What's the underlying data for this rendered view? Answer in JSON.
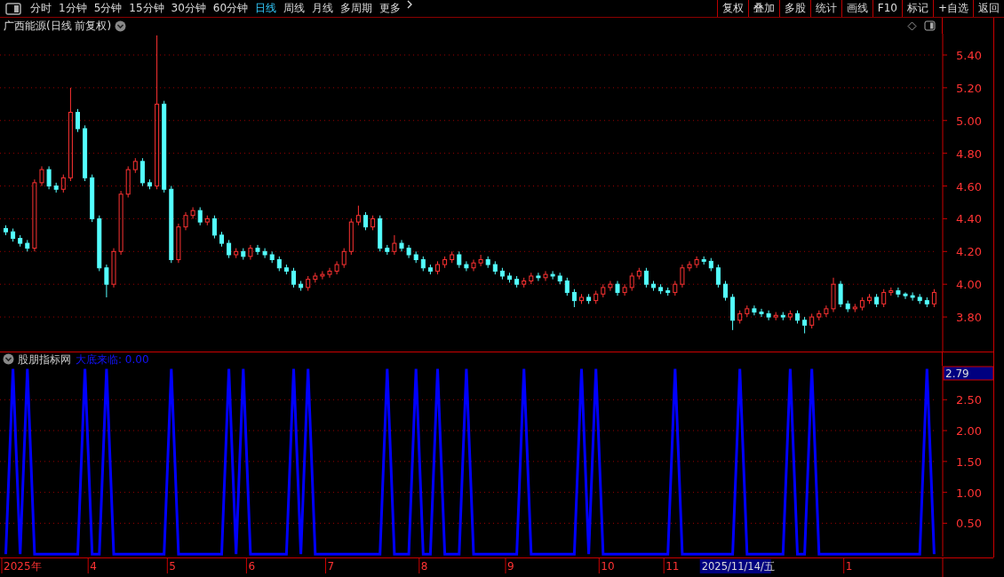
{
  "toolbar": {
    "periods": [
      {
        "label": "分时",
        "selected": false
      },
      {
        "label": "1分钟",
        "selected": false
      },
      {
        "label": "5分钟",
        "selected": false
      },
      {
        "label": "15分钟",
        "selected": false
      },
      {
        "label": "30分钟",
        "selected": false
      },
      {
        "label": "60分钟",
        "selected": false
      },
      {
        "label": "日线",
        "selected": true
      },
      {
        "label": "周线",
        "selected": false
      },
      {
        "label": "月线",
        "selected": false
      },
      {
        "label": "多周期",
        "selected": false
      },
      {
        "label": "更多",
        "selected": false
      }
    ],
    "buttons": [
      "复权",
      "叠加",
      "多股",
      "统计",
      "画线",
      "F10",
      "标记",
      "+自选",
      "返回"
    ]
  },
  "price_chart": {
    "title": "广西能源(日线 前复权)",
    "chart_data": {
      "type": "candlestick",
      "grid": true,
      "ylim": [
        3.589,
        5.53
      ],
      "ohlc": [
        [
          4.34,
          4.36,
          4.3,
          4.32
        ],
        [
          4.32,
          4.34,
          4.26,
          4.28
        ],
        [
          4.28,
          4.3,
          4.23,
          4.25
        ],
        [
          4.25,
          4.27,
          4.2,
          4.22
        ],
        [
          4.22,
          4.64,
          4.2,
          4.62
        ],
        [
          4.62,
          4.72,
          4.6,
          4.7
        ],
        [
          4.7,
          4.72,
          4.58,
          4.6
        ],
        [
          4.6,
          4.62,
          4.56,
          4.58
        ],
        [
          4.58,
          4.67,
          4.56,
          4.65
        ],
        [
          4.65,
          5.2,
          4.63,
          5.05
        ],
        [
          5.05,
          5.07,
          4.93,
          4.95
        ],
        [
          4.95,
          4.97,
          4.63,
          4.65
        ],
        [
          4.65,
          4.67,
          4.38,
          4.4
        ],
        [
          4.4,
          4.42,
          4.08,
          4.1
        ],
        [
          4.1,
          4.12,
          3.92,
          4.0
        ],
        [
          4.0,
          4.22,
          3.98,
          4.2
        ],
        [
          4.2,
          4.57,
          4.18,
          4.55
        ],
        [
          4.55,
          4.72,
          4.53,
          4.7
        ],
        [
          4.7,
          4.77,
          4.68,
          4.75
        ],
        [
          4.75,
          4.77,
          4.6,
          4.62
        ],
        [
          4.62,
          4.64,
          4.58,
          4.6
        ],
        [
          4.6,
          5.52,
          4.58,
          5.1
        ],
        [
          5.1,
          5.12,
          4.56,
          4.58
        ],
        [
          4.58,
          4.6,
          4.13,
          4.15
        ],
        [
          4.15,
          4.37,
          4.13,
          4.35
        ],
        [
          4.35,
          4.44,
          4.33,
          4.42
        ],
        [
          4.42,
          4.47,
          4.4,
          4.45
        ],
        [
          4.45,
          4.47,
          4.36,
          4.38
        ],
        [
          4.38,
          4.42,
          4.36,
          4.4
        ],
        [
          4.4,
          4.42,
          4.28,
          4.3
        ],
        [
          4.3,
          4.32,
          4.23,
          4.25
        ],
        [
          4.25,
          4.27,
          4.16,
          4.18
        ],
        [
          4.18,
          4.22,
          4.16,
          4.2
        ],
        [
          4.2,
          4.22,
          4.15,
          4.17
        ],
        [
          4.17,
          4.24,
          4.15,
          4.22
        ],
        [
          4.22,
          4.24,
          4.18,
          4.2
        ],
        [
          4.2,
          4.22,
          4.16,
          4.18
        ],
        [
          4.18,
          4.2,
          4.13,
          4.15
        ],
        [
          4.15,
          4.17,
          4.08,
          4.1
        ],
        [
          4.1,
          4.12,
          4.06,
          4.08
        ],
        [
          4.08,
          4.1,
          3.98,
          4.0
        ],
        [
          4.0,
          4.02,
          3.96,
          3.98
        ],
        [
          3.98,
          4.05,
          3.96,
          4.03
        ],
        [
          4.03,
          4.07,
          4.01,
          4.05
        ],
        [
          4.05,
          4.08,
          4.03,
          4.06
        ],
        [
          4.06,
          4.1,
          4.04,
          4.08
        ],
        [
          4.08,
          4.14,
          4.06,
          4.12
        ],
        [
          4.12,
          4.22,
          4.1,
          4.2
        ],
        [
          4.2,
          4.4,
          4.18,
          4.38
        ],
        [
          4.38,
          4.48,
          4.36,
          4.42
        ],
        [
          4.42,
          4.44,
          4.33,
          4.35
        ],
        [
          4.35,
          4.42,
          4.33,
          4.4
        ],
        [
          4.4,
          4.42,
          4.2,
          4.22
        ],
        [
          4.22,
          4.24,
          4.18,
          4.2
        ],
        [
          4.2,
          4.3,
          4.18,
          4.25
        ],
        [
          4.25,
          4.27,
          4.2,
          4.22
        ],
        [
          4.22,
          4.24,
          4.16,
          4.18
        ],
        [
          4.18,
          4.2,
          4.13,
          4.15
        ],
        [
          4.15,
          4.17,
          4.08,
          4.1
        ],
        [
          4.1,
          4.12,
          4.06,
          4.08
        ],
        [
          4.08,
          4.14,
          4.06,
          4.12
        ],
        [
          4.12,
          4.17,
          4.1,
          4.15
        ],
        [
          4.15,
          4.2,
          4.13,
          4.18
        ],
        [
          4.18,
          4.2,
          4.1,
          4.12
        ],
        [
          4.12,
          4.14,
          4.08,
          4.1
        ],
        [
          4.1,
          4.15,
          4.08,
          4.13
        ],
        [
          4.13,
          4.18,
          4.11,
          4.15
        ],
        [
          4.15,
          4.17,
          4.1,
          4.12
        ],
        [
          4.12,
          4.14,
          4.06,
          4.08
        ],
        [
          4.08,
          4.1,
          4.03,
          4.05
        ],
        [
          4.05,
          4.07,
          4.01,
          4.03
        ],
        [
          4.03,
          4.05,
          3.98,
          4.0
        ],
        [
          4.0,
          4.04,
          3.98,
          4.02
        ],
        [
          4.02,
          4.07,
          4.0,
          4.05
        ],
        [
          4.05,
          4.07,
          4.02,
          4.04
        ],
        [
          4.04,
          4.08,
          4.02,
          4.06
        ],
        [
          4.06,
          4.08,
          4.03,
          4.05
        ],
        [
          4.05,
          4.07,
          4.0,
          4.02
        ],
        [
          4.02,
          4.04,
          3.93,
          3.95
        ],
        [
          3.95,
          3.97,
          3.86,
          3.9
        ],
        [
          3.9,
          3.94,
          3.88,
          3.92
        ],
        [
          3.92,
          3.94,
          3.88,
          3.9
        ],
        [
          3.9,
          3.96,
          3.88,
          3.94
        ],
        [
          3.94,
          4.0,
          3.92,
          3.98
        ],
        [
          3.98,
          4.02,
          3.96,
          4.0
        ],
        [
          4.0,
          4.02,
          3.93,
          3.95
        ],
        [
          3.95,
          4.0,
          3.93,
          3.98
        ],
        [
          3.98,
          4.07,
          3.96,
          4.05
        ],
        [
          4.05,
          4.1,
          4.03,
          4.08
        ],
        [
          4.08,
          4.1,
          3.98,
          4.0
        ],
        [
          4.0,
          4.02,
          3.96,
          3.98
        ],
        [
          3.98,
          4.0,
          3.94,
          3.96
        ],
        [
          3.96,
          3.98,
          3.93,
          3.95
        ],
        [
          3.95,
          4.02,
          3.93,
          4.0
        ],
        [
          4.0,
          4.12,
          3.98,
          4.1
        ],
        [
          4.1,
          4.14,
          4.08,
          4.12
        ],
        [
          4.12,
          4.17,
          4.1,
          4.15
        ],
        [
          4.15,
          4.17,
          4.12,
          4.14
        ],
        [
          4.14,
          4.16,
          4.08,
          4.1
        ],
        [
          4.1,
          4.12,
          3.98,
          4.0
        ],
        [
          4.0,
          4.02,
          3.9,
          3.92
        ],
        [
          3.92,
          3.94,
          3.72,
          3.78
        ],
        [
          3.78,
          3.84,
          3.76,
          3.82
        ],
        [
          3.82,
          3.87,
          3.8,
          3.85
        ],
        [
          3.85,
          3.87,
          3.81,
          3.83
        ],
        [
          3.83,
          3.85,
          3.8,
          3.82
        ],
        [
          3.82,
          3.84,
          3.78,
          3.8
        ],
        [
          3.8,
          3.83,
          3.78,
          3.81
        ],
        [
          3.81,
          3.83,
          3.78,
          3.8
        ],
        [
          3.8,
          3.84,
          3.78,
          3.82
        ],
        [
          3.82,
          3.84,
          3.76,
          3.78
        ],
        [
          3.78,
          3.8,
          3.7,
          3.75
        ],
        [
          3.75,
          3.82,
          3.73,
          3.8
        ],
        [
          3.8,
          3.84,
          3.78,
          3.82
        ],
        [
          3.82,
          3.87,
          3.8,
          3.85
        ],
        [
          3.85,
          4.04,
          3.83,
          4.0
        ],
        [
          4.0,
          4.02,
          3.86,
          3.88
        ],
        [
          3.88,
          3.9,
          3.83,
          3.85
        ],
        [
          3.85,
          3.88,
          3.83,
          3.86
        ],
        [
          3.86,
          3.92,
          3.84,
          3.9
        ],
        [
          3.9,
          3.94,
          3.88,
          3.92
        ],
        [
          3.92,
          3.94,
          3.86,
          3.88
        ],
        [
          3.88,
          3.97,
          3.86,
          3.95
        ],
        [
          3.95,
          3.98,
          3.93,
          3.96
        ],
        [
          3.96,
          3.98,
          3.92,
          3.94
        ],
        [
          3.94,
          3.95,
          3.91,
          3.93
        ],
        [
          3.93,
          3.95,
          3.9,
          3.92
        ],
        [
          3.92,
          3.94,
          3.88,
          3.9
        ],
        [
          3.9,
          3.92,
          3.86,
          3.88
        ],
        [
          3.88,
          3.97,
          3.86,
          3.95
        ]
      ],
      "yticks": [
        {
          "value": 3.8,
          "label": "3.80"
        },
        {
          "value": 4.0,
          "label": "4.00"
        },
        {
          "value": 4.2,
          "label": "4.20"
        },
        {
          "value": 4.4,
          "label": "4.40"
        },
        {
          "value": 4.6,
          "label": "4.60"
        },
        {
          "value": 4.8,
          "label": "4.80"
        },
        {
          "value": 5.0,
          "label": "5.00"
        },
        {
          "value": 5.2,
          "label": "5.20"
        },
        {
          "value": 5.4,
          "label": "5.40"
        }
      ]
    }
  },
  "indicator": {
    "name": "股朋指标网",
    "series_value": ": 0.00",
    "cursor_value": "2.79",
    "chart_data": {
      "type": "line",
      "grid": true,
      "ylim": [
        -0.04,
        3.05
      ],
      "series": [
        {
          "name": "大底来临",
          "color": "#0000ff",
          "values": [
            0,
            3,
            0,
            3,
            0,
            0,
            0,
            0,
            0,
            0,
            0,
            3,
            0,
            0,
            3,
            0,
            0,
            0,
            0,
            0,
            0,
            0,
            0,
            3,
            0,
            0,
            0,
            0,
            0,
            0,
            0,
            3,
            0,
            3,
            0,
            0,
            0,
            0,
            0,
            0,
            3,
            0,
            3,
            0,
            0,
            0,
            0,
            0,
            0,
            0,
            0,
            0,
            0,
            3,
            0,
            0,
            0,
            3,
            0,
            0,
            3,
            0,
            0,
            0,
            3,
            0,
            0,
            0,
            0,
            0,
            0,
            0,
            3,
            0,
            0,
            0,
            0,
            0,
            0,
            0,
            3,
            0,
            3,
            0,
            0,
            0,
            0,
            0,
            0,
            0,
            0,
            0,
            0,
            3,
            0,
            0,
            0,
            0,
            0,
            0,
            0,
            0,
            3,
            0,
            0,
            0,
            0,
            0,
            0,
            3,
            0,
            0,
            3,
            0,
            0,
            0,
            0,
            0,
            0,
            0,
            0,
            0,
            0,
            0,
            0,
            0,
            0,
            0,
            3,
            0
          ]
        }
      ],
      "yticks": [
        {
          "value": 0.5,
          "label": "0.50"
        },
        {
          "value": 1.0,
          "label": "1.00"
        },
        {
          "value": 1.5,
          "label": "1.50"
        },
        {
          "value": 2.0,
          "label": "2.00"
        },
        {
          "value": 2.5,
          "label": "2.50"
        }
      ]
    }
  },
  "x_axis": {
    "labels": [
      "2025年",
      "4",
      "5",
      "6",
      "7",
      "8",
      "9",
      "10",
      "11",
      "1"
    ],
    "cursor_label": "2025/11/14/五"
  }
}
